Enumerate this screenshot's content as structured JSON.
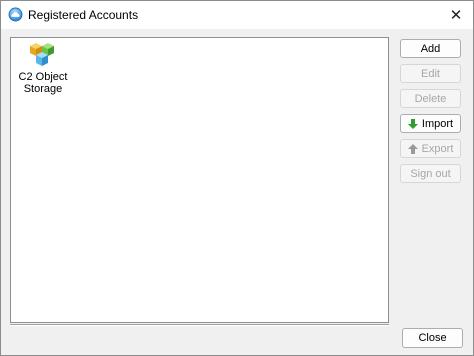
{
  "window": {
    "title": "Registered Accounts",
    "title_icon": "cloud-icon",
    "close_glyph": "✕"
  },
  "accounts": [
    {
      "label_line1": "C2 Object",
      "label_line2": "Storage",
      "icon": "c2-object-storage-icon"
    }
  ],
  "buttons": {
    "add": {
      "label": "Add",
      "enabled": true
    },
    "edit": {
      "label": "Edit",
      "enabled": false
    },
    "delete": {
      "label": "Delete",
      "enabled": false
    },
    "import": {
      "label": "Import",
      "enabled": true,
      "icon": "arrow-down-icon"
    },
    "export": {
      "label": "Export",
      "enabled": false,
      "icon": "arrow-up-icon"
    },
    "sign_out": {
      "label": "Sign out",
      "enabled": false
    },
    "close": {
      "label": "Close",
      "enabled": true
    }
  },
  "colors": {
    "import_arrow": "#2e9e2e",
    "export_arrow": "#9a9a9a",
    "cube_yellow": "#f2b72c",
    "cube_green": "#6cc24a",
    "cube_blue": "#58b7e8"
  }
}
